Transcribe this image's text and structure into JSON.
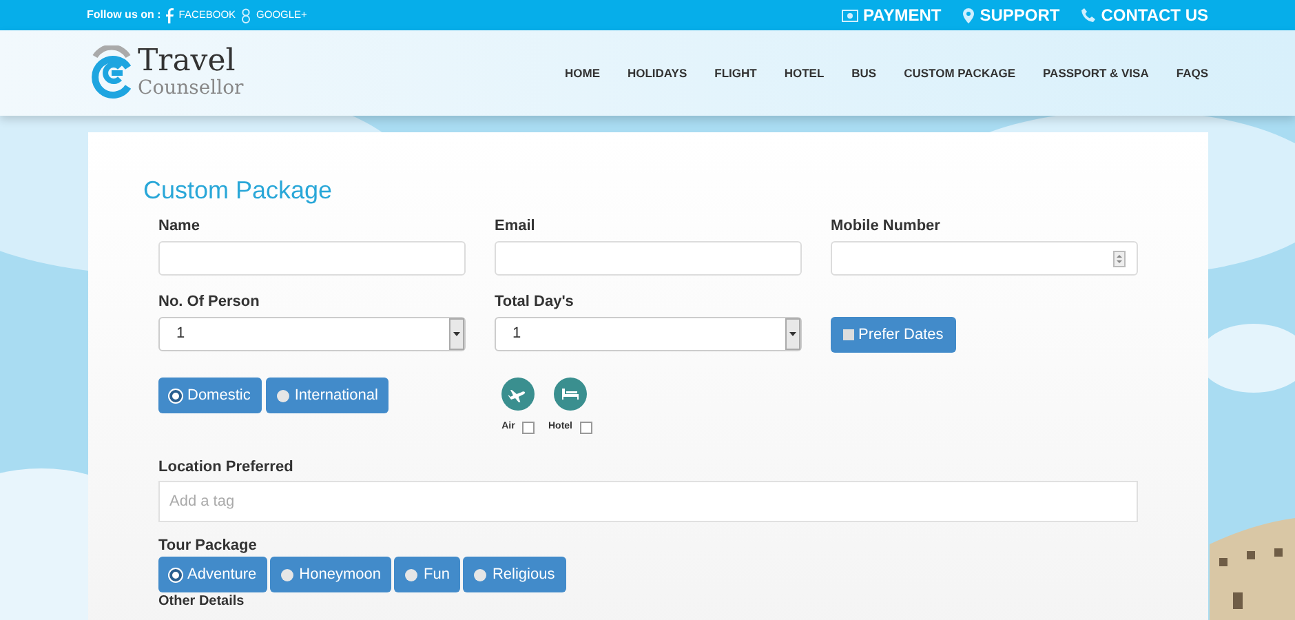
{
  "top_bar": {
    "follow_label": "Follow us on :",
    "social_links": [
      {
        "label": "FACEBOOK",
        "kind": "facebook"
      },
      {
        "label": "GOOGLE+",
        "kind": "google"
      }
    ],
    "links": [
      {
        "label": "PAYMENT",
        "kind": "payment"
      },
      {
        "label": "SUPPORT",
        "kind": "support"
      },
      {
        "label": "CONTACT US",
        "kind": "contact"
      }
    ]
  },
  "header": {
    "logo": {
      "line1": "Travel",
      "line2": "Counsellor"
    },
    "nav": [
      {
        "label": "HOME"
      },
      {
        "label": "HOLIDAYS"
      },
      {
        "label": "FLIGHT"
      },
      {
        "label": "HOTEL"
      },
      {
        "label": "BUS"
      },
      {
        "label": "CUSTOM PACKAGE"
      },
      {
        "label": "PASSPORT & VISA"
      },
      {
        "label": "FAQS"
      }
    ]
  },
  "form": {
    "title": "Custom Package",
    "fields": [
      {
        "label": "Name",
        "kind": "text"
      },
      {
        "label": "Email",
        "kind": "text"
      },
      {
        "label": "Mobile Number",
        "kind": "number"
      },
      {
        "label": "No. Of Person",
        "kind": "select",
        "value": "1"
      },
      {
        "label": "Total Day's",
        "kind": "select",
        "value": "1"
      },
      {
        "label": "Prefer Dates",
        "kind": "checkbutton",
        "checked": false
      }
    ],
    "trip_type": [
      {
        "label": "Domestic",
        "selected": true
      },
      {
        "label": "International",
        "selected": false
      }
    ],
    "services": [
      {
        "label": "Air",
        "kind": "air",
        "checked": false
      },
      {
        "label": "Hotel",
        "kind": "hotel",
        "checked": false
      }
    ],
    "location": {
      "label": "Location Preferred",
      "placeholder": "Add a tag"
    },
    "tour_package": {
      "label": "Tour Package",
      "options": [
        {
          "label": "Adventure",
          "selected": true
        },
        {
          "label": "Honeymoon",
          "selected": false
        },
        {
          "label": "Fun",
          "selected": false
        },
        {
          "label": "Religious",
          "selected": false
        }
      ]
    },
    "other_details": {
      "label": "Other Details"
    }
  }
}
